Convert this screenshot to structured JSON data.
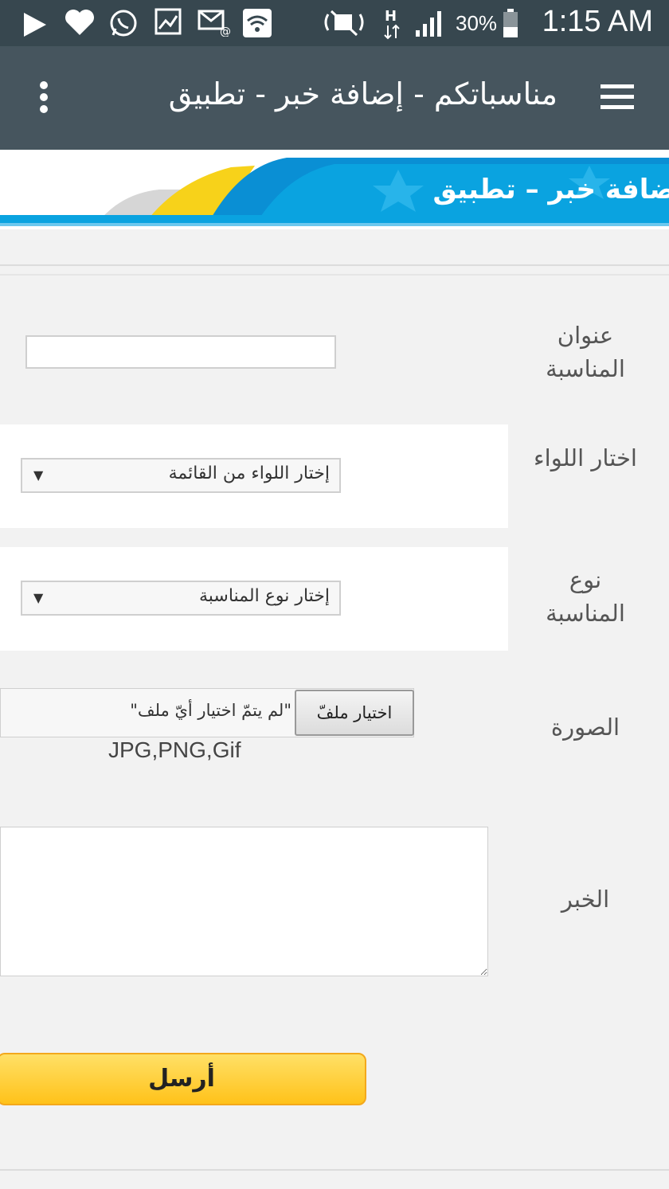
{
  "status_bar": {
    "battery_percent": "30%",
    "time": "1:15 AM"
  },
  "toolbar": {
    "title": "مناسباتكم - إضافة خبر - تطبيق"
  },
  "banner": {
    "text": "إضافة خبر – تطبيق"
  },
  "form": {
    "title_label": "عنوان المناسبة",
    "title_value": "",
    "district_label": "اختار اللواء",
    "district_select": "إختار اللواء من القائمة",
    "type_label": "نوع المناسبة",
    "type_select": "إختار نوع المناسبة",
    "image_label": "الصورة",
    "file_button": "اختيار ملفّ",
    "file_status": "\"لم يتمّ اختيار أيّ ملف\"",
    "file_hint": "JPG,PNG,Gif",
    "news_label": "الخبر",
    "submit": "أرسل"
  },
  "colors": {
    "status_bar": "#37474f",
    "toolbar": "#46555e",
    "banner_blue": "#0aa3e0",
    "submit_yellow": "#ffc21a"
  }
}
